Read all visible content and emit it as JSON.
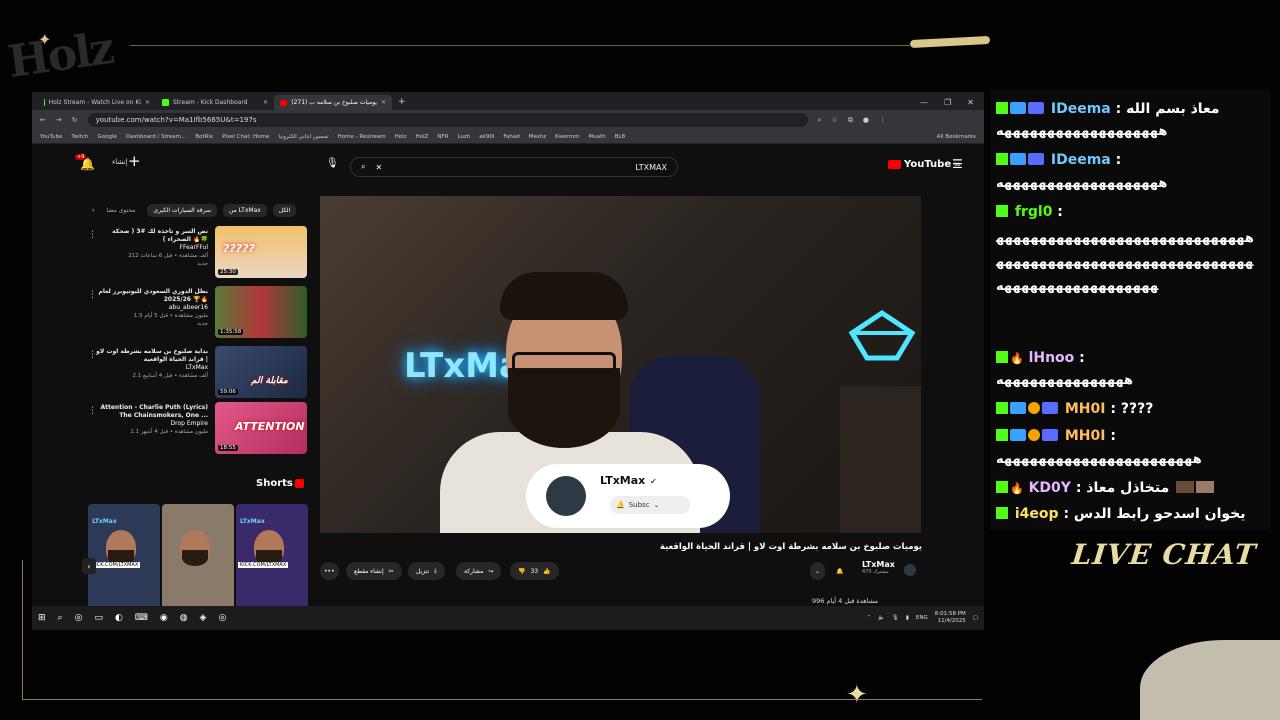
{
  "overlay": {
    "logo_text": "Holz",
    "live_chat_label": "LIVE CHAT"
  },
  "browser": {
    "tabs": [
      {
        "label": "Holz Stream - Watch Live on Ki",
        "icon": "kick-icon"
      },
      {
        "label": "Stream - Kick Dashboard",
        "icon": "kick-icon"
      },
      {
        "label": "(271) يوميات صلبوخ بن سلامه ب",
        "icon": "youtube-icon",
        "active": true
      }
    ],
    "url": "youtube.com/watch?v=Ma1Ifb5665U&t=197s",
    "bookmarks": [
      "YouTube",
      "Twitch",
      "Google",
      "Dashboard / Stream...",
      "BotRix",
      "Pixel Chat: Home",
      "تحسين انتاني الكترونيا",
      "Home - Restream",
      "Holz",
      "HolZ",
      "NFR",
      "Luzh",
      "ak90l",
      "Fahad",
      "Meshz",
      "Kwermm",
      "Muath",
      "BL8"
    ],
    "all_bookmarks": "All Bookmarks"
  },
  "youtube": {
    "create_label": "إنشاء",
    "notif_count": "+9",
    "search_query": "LTXMAX",
    "logo": "YouTube",
    "region": "SA",
    "chips": [
      "الكل",
      "من LTxMax",
      "سرقة السيارات الكبرى",
      "محتوى مشا"
    ],
    "recommendations": [
      {
        "title": "نص السر و تاخذه لك #3 ( ضحكة الصحراء ) 🔥🍀",
        "channel": "FFearFFul",
        "meta": "212 ألف مشاهدة • قبل 6 ساعات",
        "badge": "جديد",
        "duration": "25:30",
        "thumb_text": "?????"
      },
      {
        "title": "بطل الدوري السعودي لليوتيوبرز لعام 2025/26 🏆🔥",
        "channel": "abu_abeer16",
        "meta": "1.5 مليون مشاهدة • قبل 5 أيام",
        "badge": "جديد",
        "duration": "1:35:58",
        "thumb_text": ""
      },
      {
        "title": "بداية صلبوخ بن سلامه بشرطة اوت لاو | قراند الحياة الواقعية",
        "channel": "LTxMax",
        "meta": "2.1 ألف مشاهدة • قبل 4 أسابيع",
        "badge": "",
        "duration": "59:06",
        "thumb_text": "مقابلة الم"
      },
      {
        "title": "Attention - Charlie Puth (Lyrics) The Chainsmokers, One ...",
        "channel": "Drop Empire",
        "meta": "1.1 مليون مشاهدة • قبل 4 أشهر",
        "badge": "",
        "duration": "18:55",
        "thumb_text": "ATTENTION"
      }
    ],
    "shorts_label": "Shorts",
    "shorts": [
      {
        "label": "LTxMax",
        "tag": "KICK.COM/LTXMAX"
      },
      {
        "label": "",
        "tag": ""
      },
      {
        "label": "LTxMax",
        "tag": "KICK.COM/LTXMAX"
      }
    ],
    "video": {
      "neon_text": "LTxMa",
      "card_name": "LTxMax",
      "card_button": "Subsc",
      "title": "يوميات صلبوخ بن سلامه بشرطة اوت لاو | قراند الحياة الواقعية",
      "channel": "LTxMax",
      "subscribers": "470 مشترك",
      "likes": "33",
      "share": "مشاركة",
      "download": "تنزيل",
      "clip": "إنشاء مقطع",
      "views": "996 مشاهدة قبل 4 أيام"
    }
  },
  "taskbar": {
    "lang": "ENG",
    "time": "8:01:58 PM",
    "date": "11/4/2025"
  },
  "chat": {
    "messages": [
      {
        "user": "IDeema",
        "text": "معاذ بسم الله",
        "cont": "هههههههههههههههههههه"
      },
      {
        "user": "IDeema",
        "text": "",
        "cont": "هههههههههههههههههههه"
      },
      {
        "user": "frgl0",
        "text": "",
        "cont": "ههههههههههههههههههههههههههههههههههههههههههههههههههههههههههههههههههههههههههههههه"
      },
      {
        "user": "lHnoo",
        "text": "",
        "cont": "هههههههههههههههه"
      },
      {
        "user": "MH0I",
        "text": "????",
        "cont": ""
      },
      {
        "user": "MH0I",
        "text": "",
        "cont": "هههههههههههههههههههههههه"
      },
      {
        "user": "KD0Y",
        "text": "متخاذل معاذ",
        "cont": ""
      },
      {
        "user": "i4eop",
        "text": "يخوان اسدحو رابط الدس",
        "cont": ""
      }
    ]
  }
}
